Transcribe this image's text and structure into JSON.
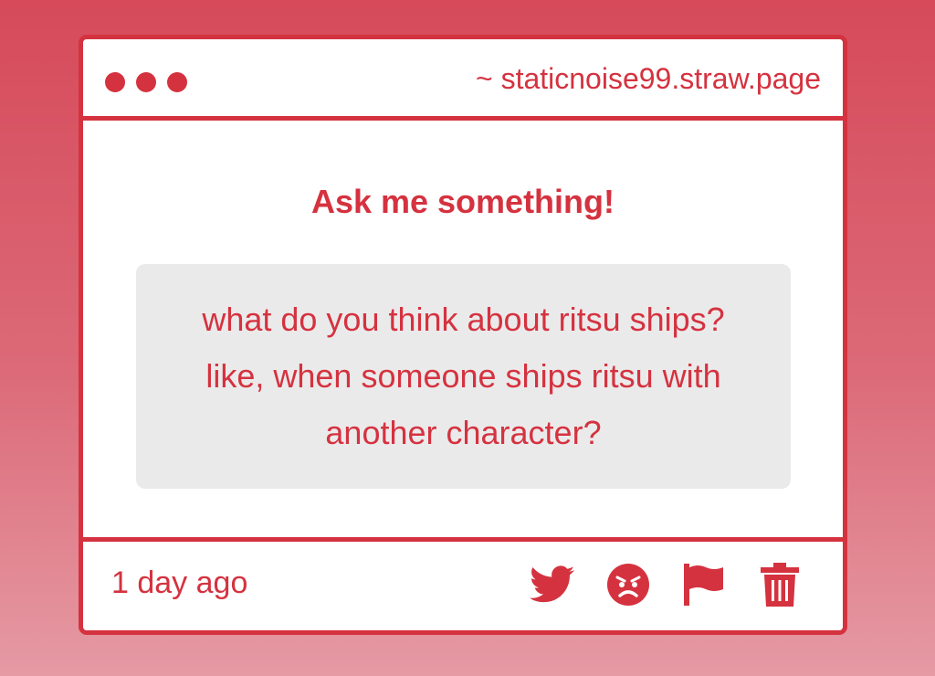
{
  "window": {
    "url": "~ staticnoise99.straw.page"
  },
  "main": {
    "heading": "Ask me something!",
    "question": "what do you think about ritsu ships? like, when someone ships ritsu with another character?"
  },
  "footer": {
    "timestamp": "1 day ago",
    "actions": [
      {
        "name": "twitter-share",
        "icon": "twitter-icon"
      },
      {
        "name": "angry-reaction",
        "icon": "angry-face-icon"
      },
      {
        "name": "report",
        "icon": "flag-icon"
      },
      {
        "name": "delete",
        "icon": "trash-icon"
      }
    ]
  },
  "colors": {
    "accent": "#d5323f",
    "question_background": "#ebeaeb",
    "page_background_top": "#d64a5a",
    "page_background_bottom": "#e59aa4"
  }
}
